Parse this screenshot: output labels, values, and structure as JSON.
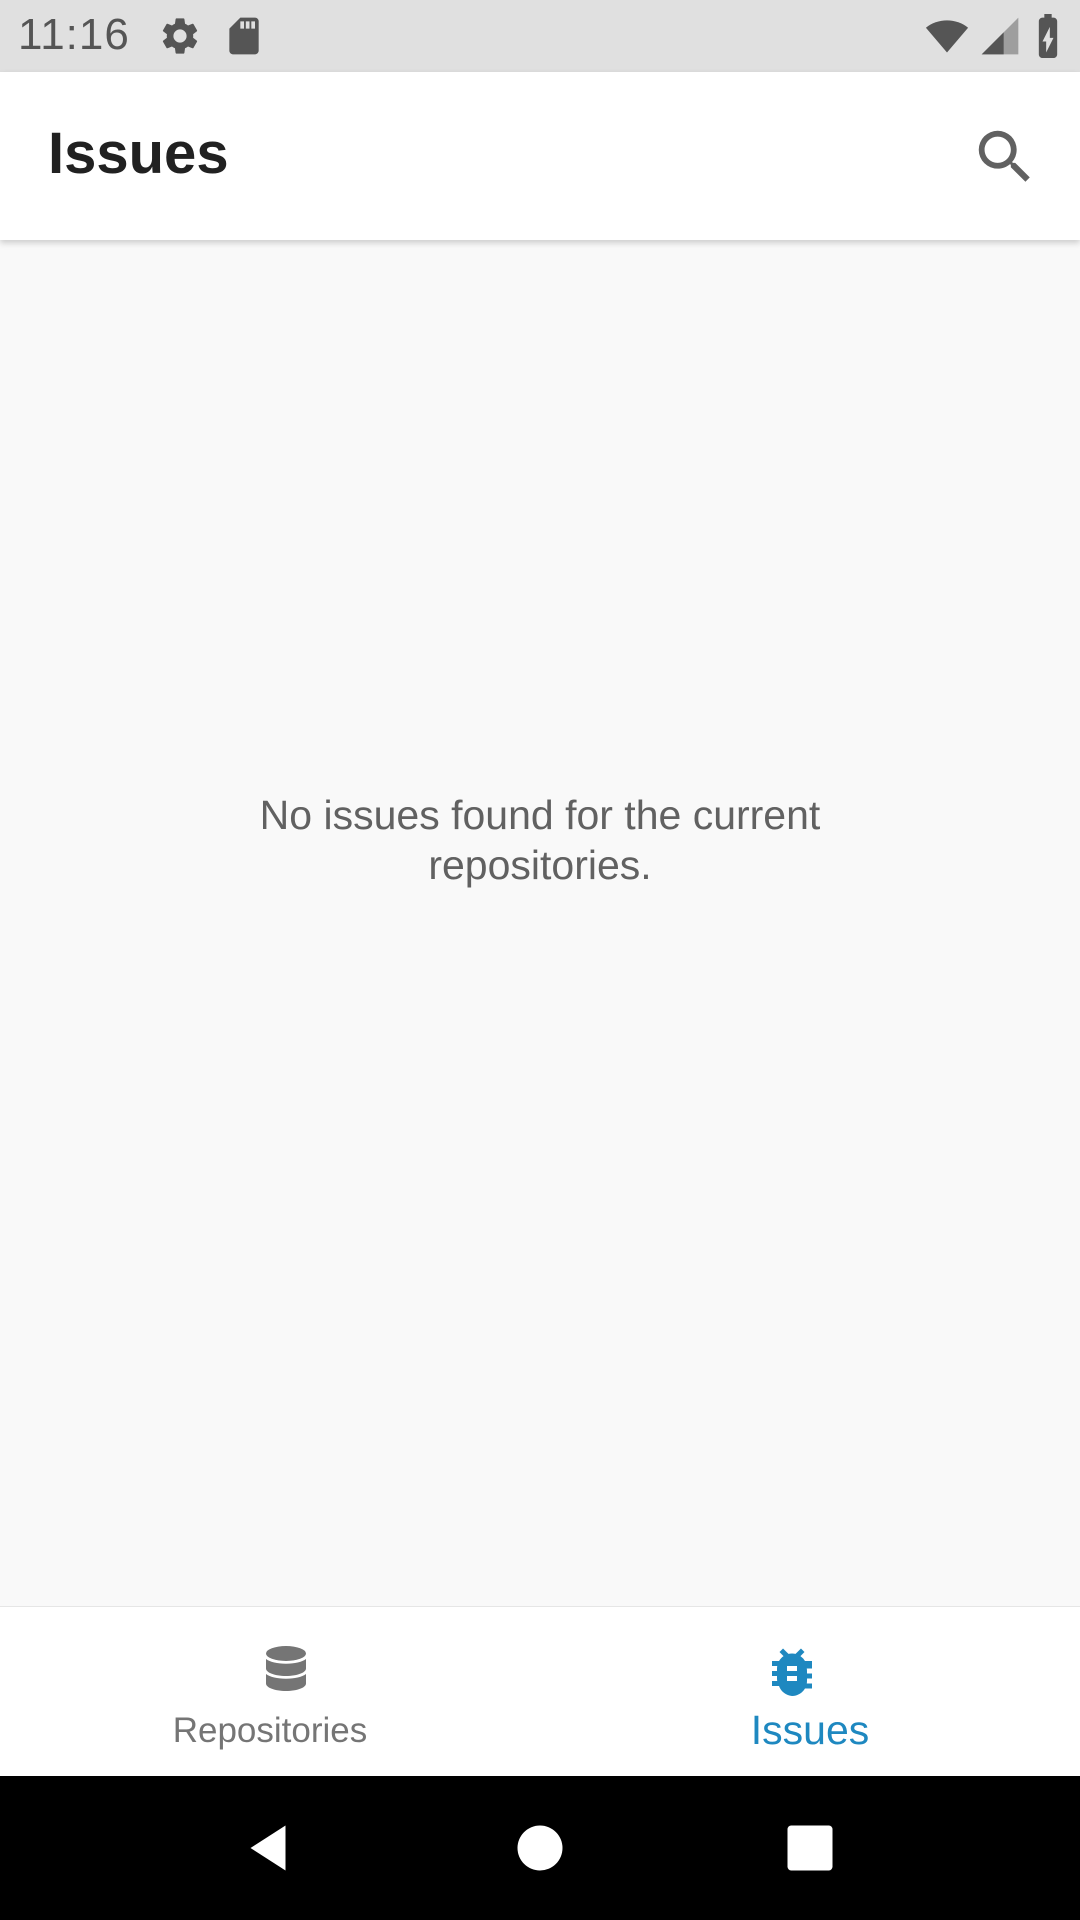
{
  "status_bar": {
    "time": "11:16",
    "icons": [
      "gear-icon",
      "sd-card-icon",
      "wifi-icon",
      "signal-icon",
      "battery-charging-icon"
    ]
  },
  "app_bar": {
    "title": "Issues",
    "search_icon": "search-icon"
  },
  "content": {
    "empty_message": "No issues found for the current repositories."
  },
  "bottom_nav": {
    "items": [
      {
        "label": "Repositories",
        "icon": "database-icon",
        "active": false
      },
      {
        "label": "Issues",
        "icon": "bug-icon",
        "active": true
      }
    ],
    "inactive_color": "#757575",
    "active_color": "#1e88c0"
  },
  "system_nav": {
    "buttons": [
      "back-icon",
      "home-icon",
      "recents-icon"
    ]
  }
}
